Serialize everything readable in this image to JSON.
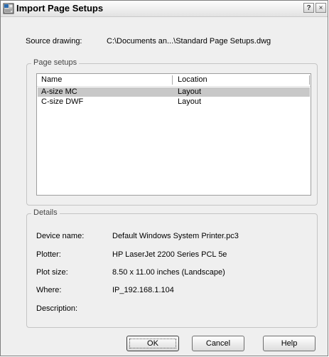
{
  "window": {
    "title": "Import Page Setups",
    "help_button": "?",
    "close_button": "×"
  },
  "source": {
    "label": "Source drawing:",
    "path": "C:\\Documents an...\\Standard Page Setups.dwg"
  },
  "page_setups": {
    "legend": "Page setups",
    "columns": [
      "Name",
      "Location"
    ],
    "rows": [
      {
        "name": "A-size MC",
        "location": "Layout",
        "selected": true
      },
      {
        "name": "C-size DWF",
        "location": "Layout",
        "selected": false
      }
    ]
  },
  "details": {
    "legend": "Details",
    "device_name_label": "Device name:",
    "device_name_value": "Default Windows System Printer.pc3",
    "plotter_label": "Plotter:",
    "plotter_value": "HP LaserJet 2200 Series PCL 5e",
    "plot_size_label": "Plot size:",
    "plot_size_value": "8.50 x 11.00 inches (Landscape)",
    "where_label": "Where:",
    "where_value": "IP_192.168.1.104",
    "description_label": "Description:",
    "description_value": ""
  },
  "buttons": {
    "ok": "OK",
    "cancel": "Cancel",
    "help": "Help"
  },
  "colors": {
    "dialog_bg": "#efefef",
    "selected_row": "#c8c8c8"
  }
}
